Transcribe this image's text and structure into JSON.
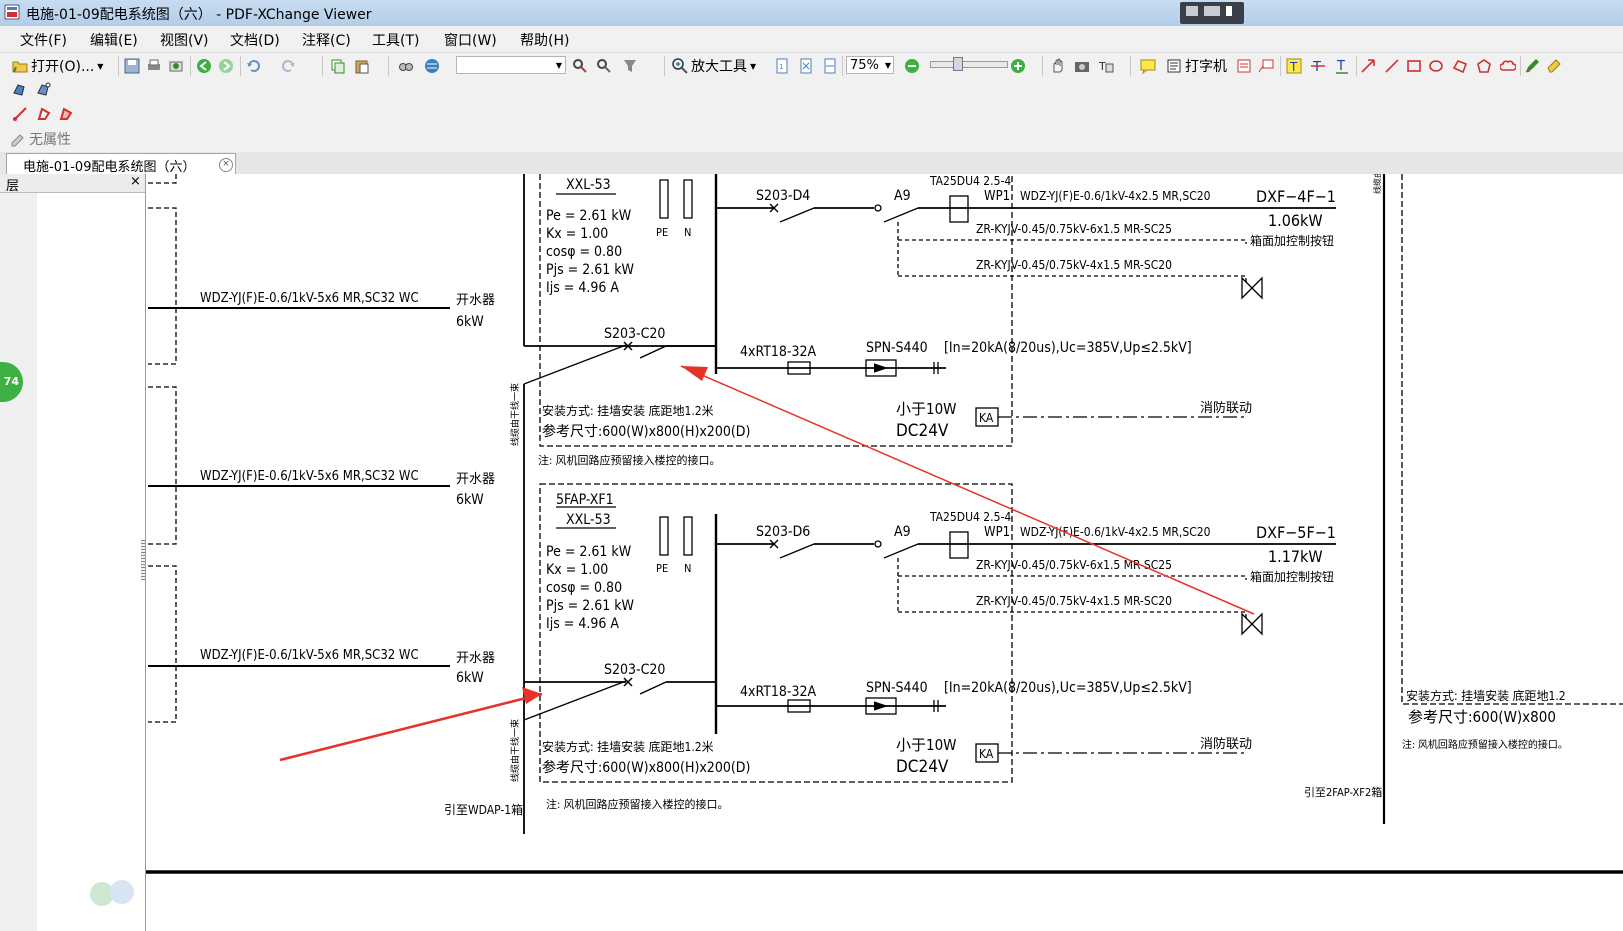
{
  "window": {
    "title": "电施-01-09配电系统图（六） - PDF-XChange Viewer"
  },
  "menu": [
    "文件(F)",
    "编辑(E)",
    "视图(V)",
    "文档(D)",
    "注释(C)",
    "工具(T)",
    "窗口(W)",
    "帮助(H)"
  ],
  "toolbar": {
    "open_label": "打开(O)...",
    "zoom_tool_label": "放大工具",
    "zoom_value": "75%",
    "typewriter_label": "打字机",
    "no_properties_label": "无属性"
  },
  "tab": {
    "label": "电施-01-09配电系统图（六）",
    "close": "×"
  },
  "side_panel": {
    "title": "层",
    "close": "×",
    "page_badge": "74"
  },
  "drawing": {
    "feeders": [
      {
        "cable": "WDZ-YJ(F)E-0.6/1kV-5x6  MR,SC32  WC",
        "load": "开水器",
        "power": "6kW"
      },
      {
        "cable": "WDZ-YJ(F)E-0.6/1kV-5x6  MR,SC32  WC",
        "load": "开水器",
        "power": "6kW"
      },
      {
        "cable": "WDZ-YJ(F)E-0.6/1kV-5x6  MR,SC32  WC",
        "load": "开水器",
        "power": "6kW"
      }
    ],
    "vertical_riser_label": "线缆由干线一束",
    "riser_bottom_label": "引至WDAP-1箱",
    "panels": [
      {
        "name": "",
        "model": "XXL-53",
        "pe": "Pe = 2.61 kW",
        "kx": "Kx = 1.00",
        "cos": "cosφ = 0.80",
        "pjs": "Pjs = 2.61 kW",
        "ijs": "Ijs = 4.96 A",
        "pe_bar": "PE",
        "n_bar": "N",
        "main_breaker": "S203-C20",
        "branch_breaker": "S203-D4",
        "contactor": "A9",
        "relay": "TA25DU4  2.5-4",
        "wp": "WP1",
        "out_cable": "WDZ-YJ(F)E-0.6/1kV-4x2.5  MR,SC20",
        "out_name": "DXF−4F−1",
        "out_power": "1.06kW",
        "ctrl1": "ZR-KYJV-0.45/0.75kV-6x1.5  MR-SC25",
        "ctrl_note": "箱面加控制按钮",
        "ctrl2": "ZR-KYJV-0.45/0.75kV-4x1.5  MR-SC20",
        "fuse": "4xRT18-32A",
        "spd": "SPN-S440",
        "spd_spec": "[In=20kA(8/20us),Uc=385V,Up≤2.5kV]",
        "install": "安装方式: 挂墙安装  底距地1.2米",
        "size": "参考尺寸:600(W)x800(H)x200(D)",
        "power_spec1": "小于10W",
        "power_spec2": "DC24V",
        "ka": "KA",
        "fire_link": "消防联动",
        "note": "注: 风机回路应预留接入楼控的接口。"
      },
      {
        "name": "5FAP-XF1",
        "model": "XXL-53",
        "pe": "Pe = 2.61 kW",
        "kx": "Kx = 1.00",
        "cos": "cosφ = 0.80",
        "pjs": "Pjs = 2.61 kW",
        "ijs": "Ijs = 4.96 A",
        "pe_bar": "PE",
        "n_bar": "N",
        "main_breaker": "S203-C20",
        "branch_breaker": "S203-D6",
        "contactor": "A9",
        "relay": "TA25DU4  2.5-4",
        "wp": "WP1",
        "out_cable": "WDZ-YJ(F)E-0.6/1kV-4x2.5  MR,SC20",
        "out_name": "DXF−5F−1",
        "out_power": "1.17kW",
        "ctrl1": "ZR-KYJV-0.45/0.75kV-6x1.5  MR-SC25",
        "ctrl_note": "箱面加控制按钮",
        "ctrl2": "ZR-KYJV-0.45/0.75kV-4x1.5  MR-SC20",
        "fuse": "4xRT18-32A",
        "spd": "SPN-S440",
        "spd_spec": "[In=20kA(8/20us),Uc=385V,Up≤2.5kV]",
        "install": "安装方式: 挂墙安装  底距地1.2米",
        "size": "参考尺寸:600(W)x800(H)x200(D)",
        "power_spec1": "小于10W",
        "power_spec2": "DC24V",
        "ka": "KA",
        "fire_link": "消防联动",
        "note": "注: 风机回路应预留接入楼控的接口。"
      }
    ],
    "right_fragment": {
      "install": "安装方式: 挂墙安装  底距地1.2",
      "size": "参考尺寸:600(W)x800",
      "note": "注: 风机回路应预留接入楼控的接口。",
      "ref": "引至2FAP-XF2箱",
      "top_label": "线缆由干线一束"
    },
    "annotation_color": "#e8312a"
  }
}
